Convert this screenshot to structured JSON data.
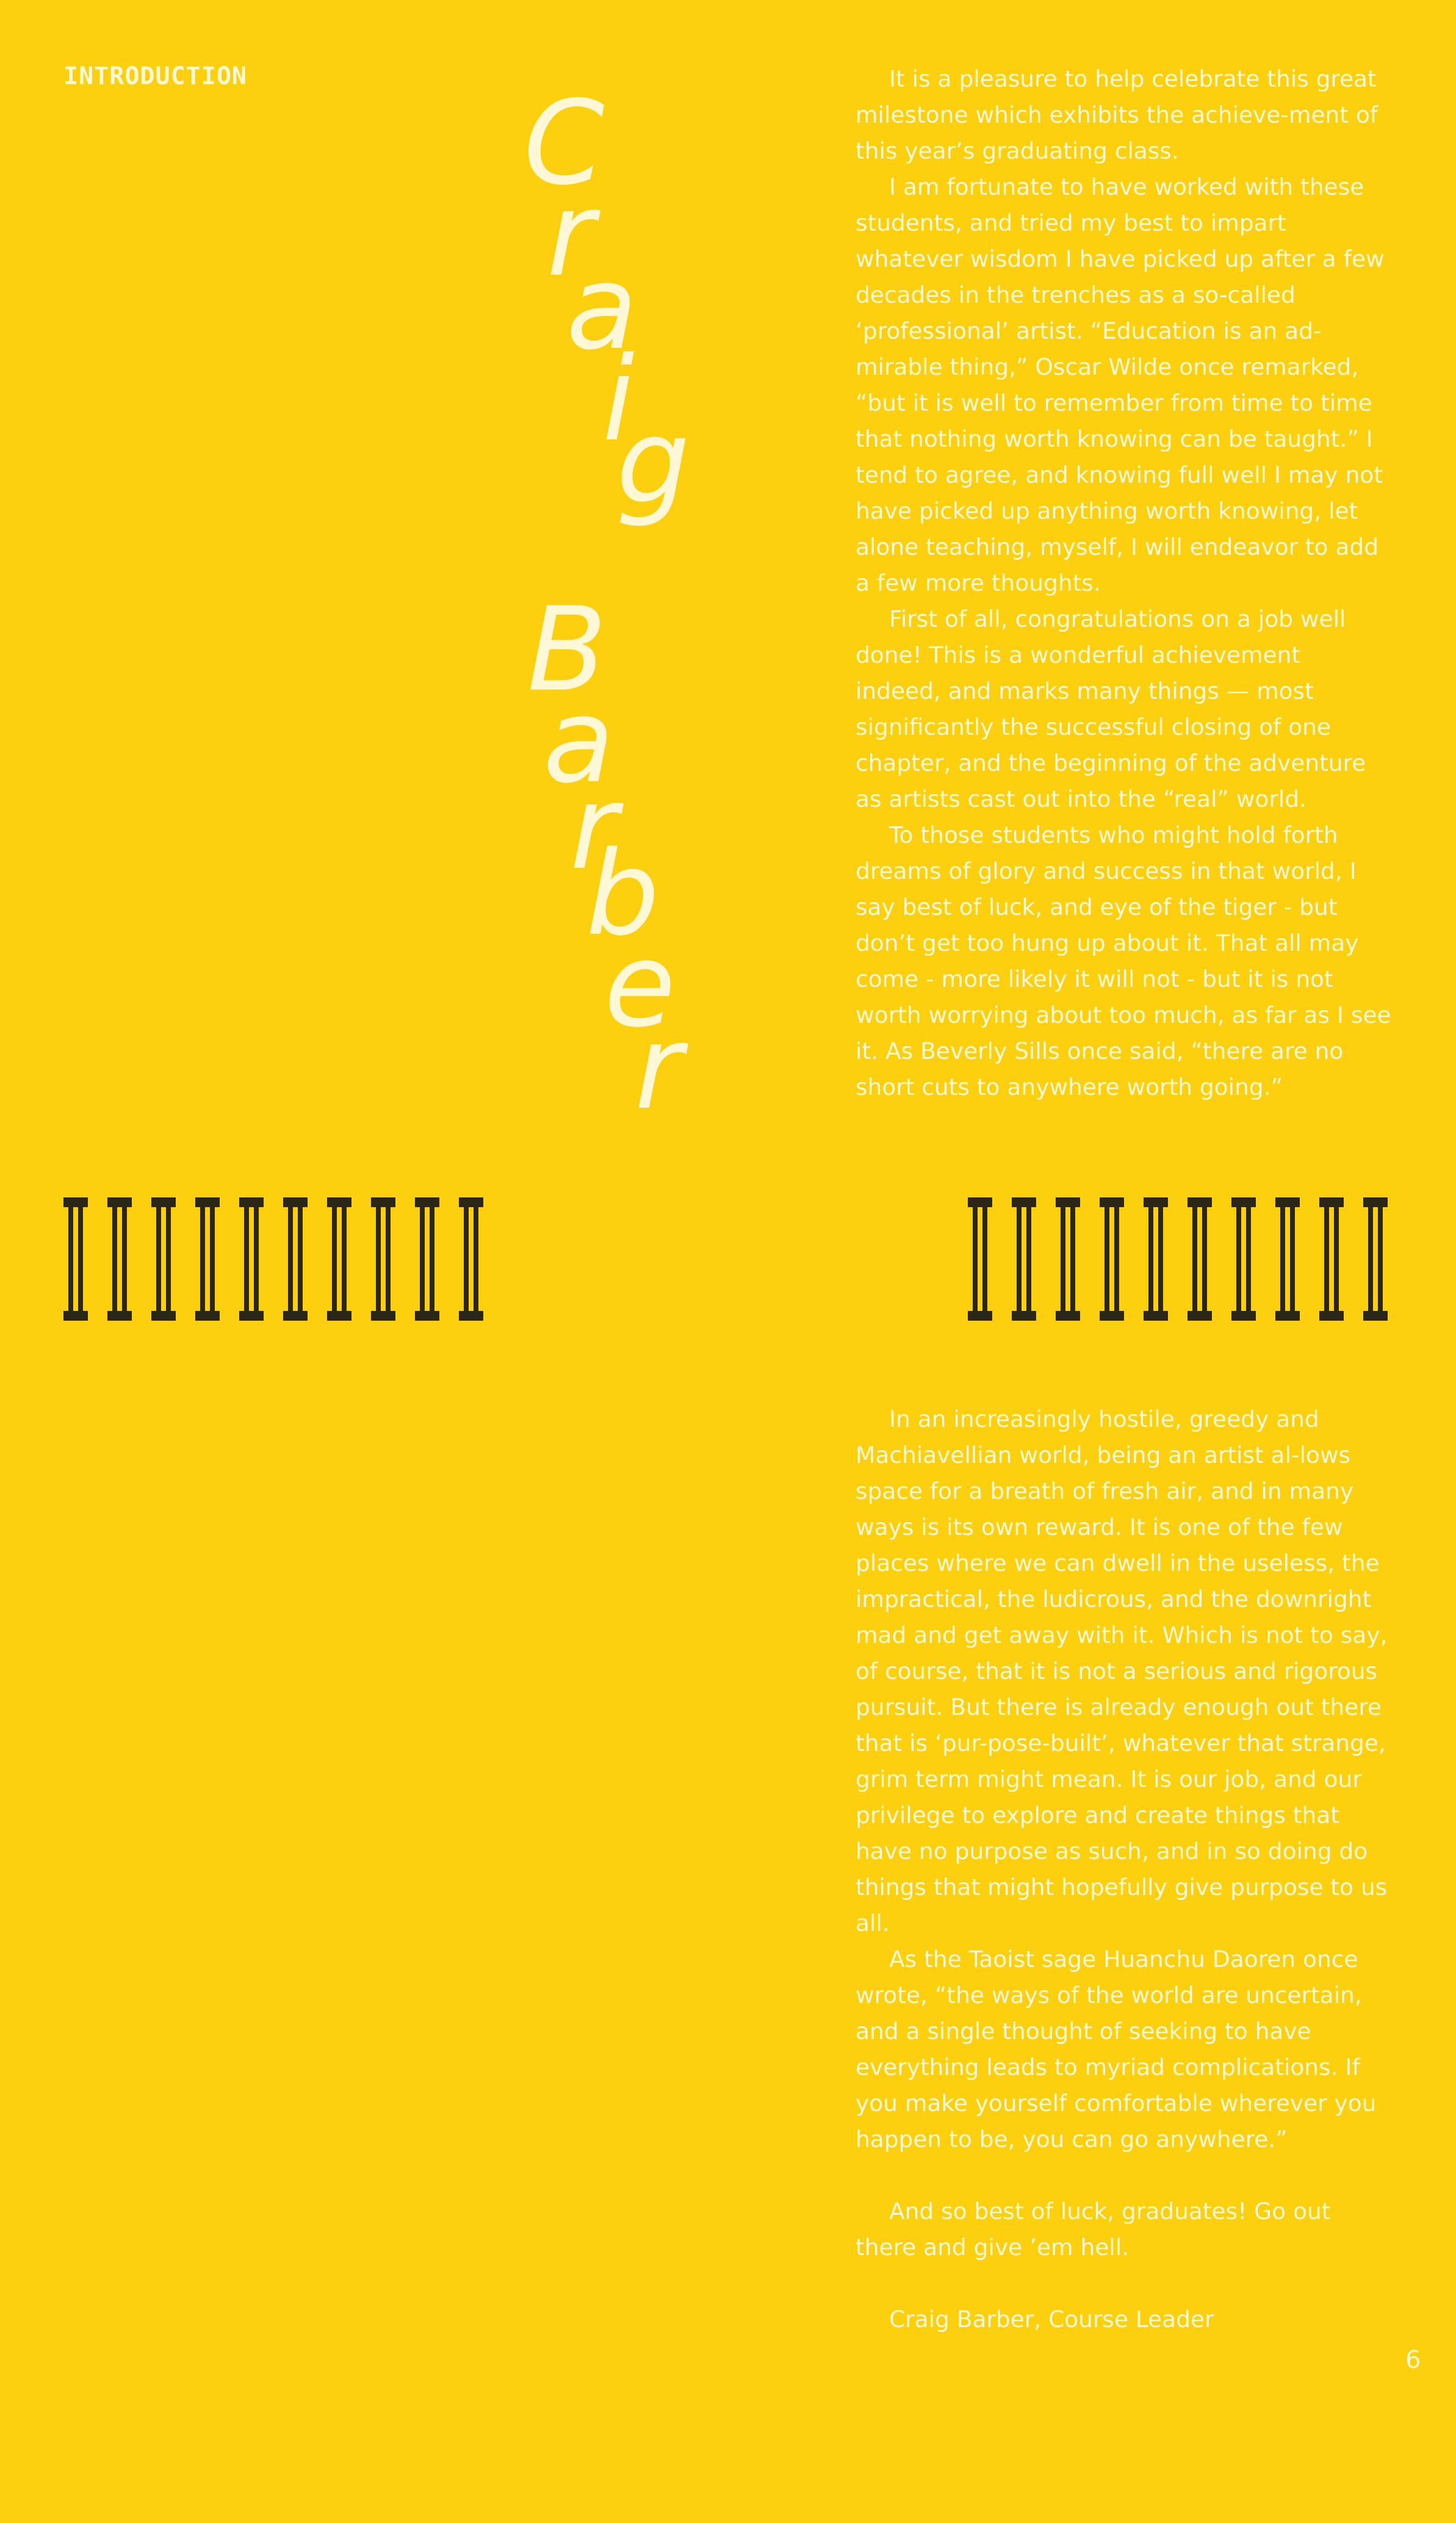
{
  "header": {
    "section_label": "INTRODUCTION"
  },
  "author_name": {
    "letters": [
      "C",
      "r",
      "a",
      "i",
      "g",
      "B",
      "a",
      "r",
      "b",
      "e",
      "r"
    ]
  },
  "body_top": {
    "paragraphs": [
      "It is a pleasure to help celebrate this great milestone which exhibits the achieve-ment of this year’s graduating class.",
      "I am fortunate to have worked with these students, and tried my best to impart whatever wisdom I have picked up after a few decades in the trenches as a so-called ‘professional’ artist. “Education is an ad-mirable thing,” Oscar Wilde once remarked, “but it is well to remember from time to time that nothing worth knowing can be taught.”  I tend to agree, and knowing full well I may not have picked up anything worth knowing, let alone teaching, myself, I will endeavor to add a few more thoughts.",
      "First of all, congratulations on a job well done! This is a wonderful achievement indeed, and marks many things — most significantly the successful closing of one chapter, and the beginning of the adventure as artists cast out into the “real” world.",
      "To those students who might hold forth dreams of glory and success in that world, I say best of luck, and eye of the tiger - but don’t get too hung up about it. That all may come - more likely it will not - but it is not worth worrying about too much, as far as I see it.  As Beverly Sills once said, “there are no short cuts to anywhere worth going.”"
    ]
  },
  "body_bottom": {
    "paragraphs": [
      "In an increasingly hostile, greedy and Machiavellian world, being an artist al-lows space for a breath of fresh air, and in many ways is its own reward. It is one of the few places where we can dwell in the useless, the impractical, the ludicrous, and the downright mad and get away with it. Which is not to say, of course, that it is not a serious and rigorous pursuit. But there is already enough out there that is ‘pur-pose-built’, whatever that strange, grim term might mean. It is our job, and our privilege to explore and create things that have no purpose as such, and in so doing do things that might hopefully give purpose to us all.",
      "As the Taoist sage Huanchu Daoren once wrote, “the ways of the world are uncertain, and a single thought of seeking to have everything leads to myriad complications. If you make yourself comfortable wherever you happen to be, you can go anywhere.”",
      "And so best of luck, graduates! Go out there and give ’em hell."
    ],
    "signature": "Craig Barber, Course Leader"
  },
  "ornaments": {
    "left_count": 10,
    "right_count": 10,
    "color": "#2a2618"
  },
  "footer": {
    "page_number": "6"
  },
  "colors": {
    "background": "#fdd00f",
    "text": "#fff8d6",
    "ornament": "#2a2618"
  }
}
